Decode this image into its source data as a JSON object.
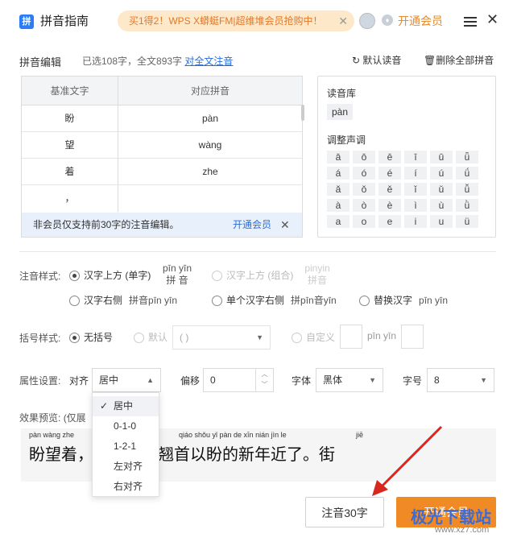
{
  "title": {
    "app_name": "拼音指南",
    "app_icon": "document-pinyin-icon",
    "banner": "买1得2！WPS X蟒蜓FM|超维堆会员抢购中！",
    "vip": "开通会员"
  },
  "editor": {
    "heading": "拼音编辑",
    "summary": "已选108字，全文893字",
    "annotate_all": "对全文注音",
    "default_reading": "默认读音",
    "delete_all": "删除全部拼音",
    "col_base": "基准文字",
    "col_pinyin": "对应拼音",
    "rows": [
      {
        "c": "盼",
        "p": "pàn"
      },
      {
        "c": "望",
        "p": "wàng"
      },
      {
        "c": "着",
        "p": "zhe"
      },
      {
        "c": "，",
        "p": ""
      }
    ],
    "notice": "非会员仅支持前30字的注音编辑。",
    "notice_link": "开通会员"
  },
  "tone": {
    "library_label": "读音库",
    "library_value": "pàn",
    "adjust_label": "调整声调",
    "grid": [
      "ā",
      "ō",
      "ē",
      "ī",
      "ū",
      "ǖ",
      "á",
      "ó",
      "é",
      "í",
      "ú",
      "ǘ",
      "ǎ",
      "ǒ",
      "ě",
      "ǐ",
      "ǔ",
      "ǚ",
      "à",
      "ò",
      "è",
      "ì",
      "ù",
      "ǜ",
      "a",
      "o",
      "e",
      "i",
      "u",
      "ü"
    ]
  },
  "style": {
    "label": "注音样式:",
    "opt1": "汉字上方 (单字)",
    "opt1_py": "pīn yīn",
    "opt1_hz": "拼 音",
    "opt2": "汉字上方 (组合)",
    "opt2_py": "pinyin",
    "opt2_hz": "拼音",
    "opt3": "汉字右侧",
    "opt3_ex": "拼音pīn yīn",
    "opt4": "单个汉字右侧",
    "opt4_ex": "拼pīn音yīn",
    "opt5": "替换汉字",
    "opt5_ex": "pīn yīn"
  },
  "bracket": {
    "label": "括号样式:",
    "none": "无括号",
    "default": "默认",
    "default_value": "( )",
    "custom": "自定义",
    "custom_ex": "pīn yīn"
  },
  "attr": {
    "label": "属性设置:",
    "align_label": "对齐",
    "align_value": "居中",
    "offset_label": "偏移",
    "offset_value": "0",
    "font_label": "字体",
    "font_value": "黑体",
    "size_label": "字号",
    "size_value": "8"
  },
  "dropdown": {
    "items": [
      "居中",
      "0-1-0",
      "1-2-1",
      "左对齐",
      "右对齐"
    ]
  },
  "preview": {
    "label": "效果预览:",
    "note": "(仅展",
    "py1": "pàn wàng zhe",
    "py2": "qiáo shǒu yǐ pàn de xīn nián jìn le",
    "py3": "jiē",
    "text": "盼望着，…………翘首以盼的新年近了。街"
  },
  "buttons": {
    "annotate": "注音30字",
    "apply": "开通会员"
  },
  "watermark": {
    "text": "极光下载站",
    "sub": "www.xz7.com"
  }
}
